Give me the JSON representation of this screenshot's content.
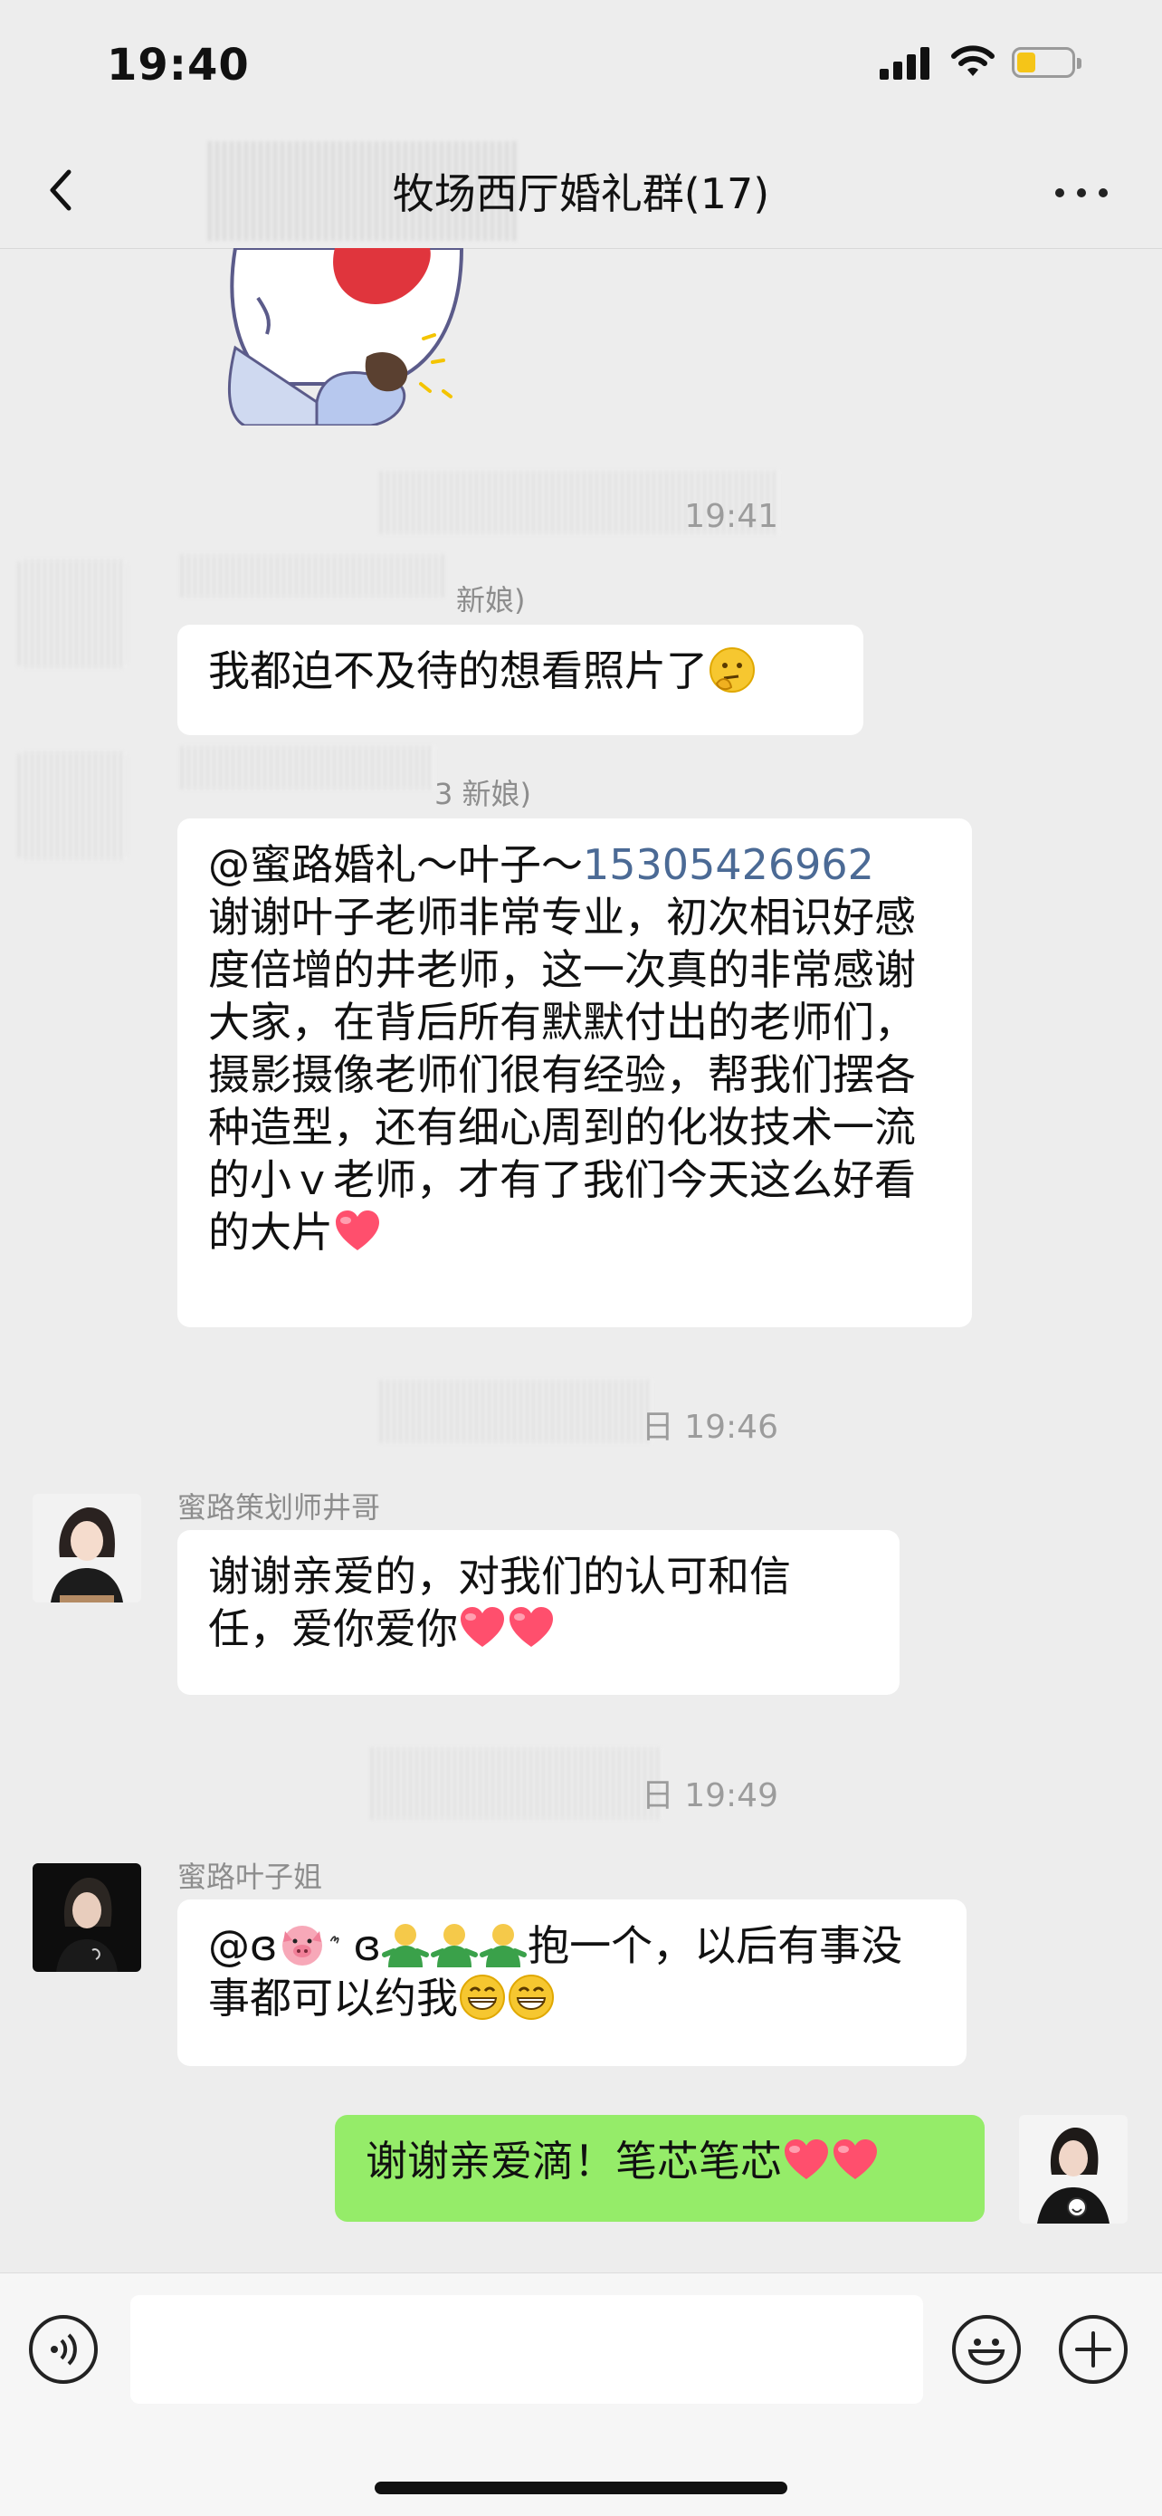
{
  "status_bar": {
    "time": "19:40"
  },
  "header": {
    "title": "牧场西厅婚礼群(17)"
  },
  "messages": [
    {
      "timestamp": "19:41",
      "sender_suffix": "新娘)",
      "text": "我都迫不及待的想看照片了",
      "emoji": "thinking-face"
    },
    {
      "sender_suffix": "3 新娘)",
      "mention_prefix": "@蜜路婚礼～叶子～",
      "mention_number": "15305426962",
      "text": "谢谢叶子老师非常专业，初次相识好感度倍增的井老师，这一次真的非常感谢大家，在背后所有默默付出的老师们，摄影摄像老师们很有经验，帮我们摆各种造型，还有细心周到的化妆技术一流的小ｖ老师，才有了我们今天这么好看的大片",
      "emoji": "heart"
    },
    {
      "timestamp": "日 19:46",
      "sender": "蜜路策划师井哥",
      "text": "谢谢亲爱的，对我们的认可和信任，爱你爱你",
      "emoji": "heart x2"
    },
    {
      "timestamp": "日 19:49",
      "sender": "蜜路叶子姐",
      "mention_prefix": "@ɞ",
      "mention_suffix": "ɞ",
      "text_after": "抱一个，以后有事没事都可以约我",
      "emoji": "grinning x2"
    },
    {
      "self": true,
      "text": "谢谢亲爱滴！笔芯笔芯",
      "emoji": "heart x2"
    }
  ],
  "colors": {
    "background": "#ededed",
    "self_bubble": "#95ec69",
    "mention": "#4b6a95",
    "battery": "#f5c518"
  },
  "icons": [
    "back-icon",
    "more-icon",
    "voice-icon",
    "emoji-icon",
    "plus-icon"
  ]
}
